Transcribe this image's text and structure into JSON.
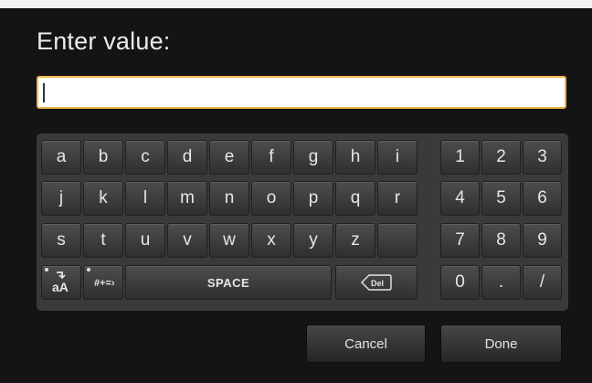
{
  "dialog": {
    "title": "Enter value:",
    "input_value": ""
  },
  "keyboard": {
    "letter_rows": [
      [
        "a",
        "b",
        "c",
        "d",
        "e",
        "f",
        "g",
        "h",
        "i"
      ],
      [
        "j",
        "k",
        "l",
        "m",
        "n",
        "o",
        "p",
        "q",
        "r"
      ],
      [
        "s",
        "t",
        "u",
        "v",
        "w",
        "x",
        "y",
        "z",
        ""
      ]
    ],
    "number_rows": [
      [
        "1",
        "2",
        "3"
      ],
      [
        "4",
        "5",
        "6"
      ],
      [
        "7",
        "8",
        "9"
      ],
      [
        "0",
        ".",
        "/"
      ]
    ],
    "case_key_label": "aA",
    "symbols_key_label": "#+=»",
    "space_label": "SPACE",
    "delete_label": "Del"
  },
  "buttons": {
    "cancel": "Cancel",
    "done": "Done"
  },
  "colors": {
    "background": "#141414",
    "keyboard_panel": "#3a3a3a",
    "input_border": "#f0b84a"
  },
  "icons": {
    "delete": "backspace-del-icon",
    "case": "case-toggle-icon",
    "symbols": "symbols-icon"
  }
}
